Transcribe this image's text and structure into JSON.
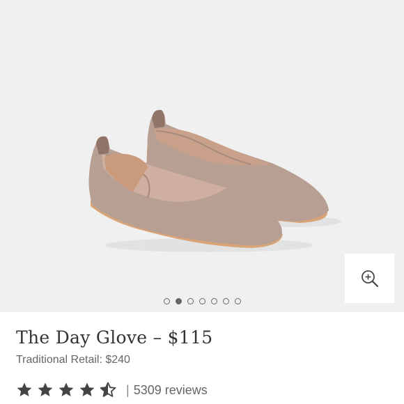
{
  "product": {
    "title": "The Day Glove – $115",
    "retail": "Traditional Retail: $240"
  },
  "gallery": {
    "image": "taupe-leather-ballet-flats",
    "slide_count": 7,
    "active_slide": 2,
    "zoom_icon": "zoom-in-icon"
  },
  "rating": {
    "value": 4.5,
    "max": 5,
    "separator": "|",
    "reviews_label": "5309 reviews"
  },
  "colors": {
    "background": "#f0f0f0",
    "shoe": "#b89f93",
    "sole": "#d9a476",
    "star": "#444444",
    "text": "#333333"
  }
}
